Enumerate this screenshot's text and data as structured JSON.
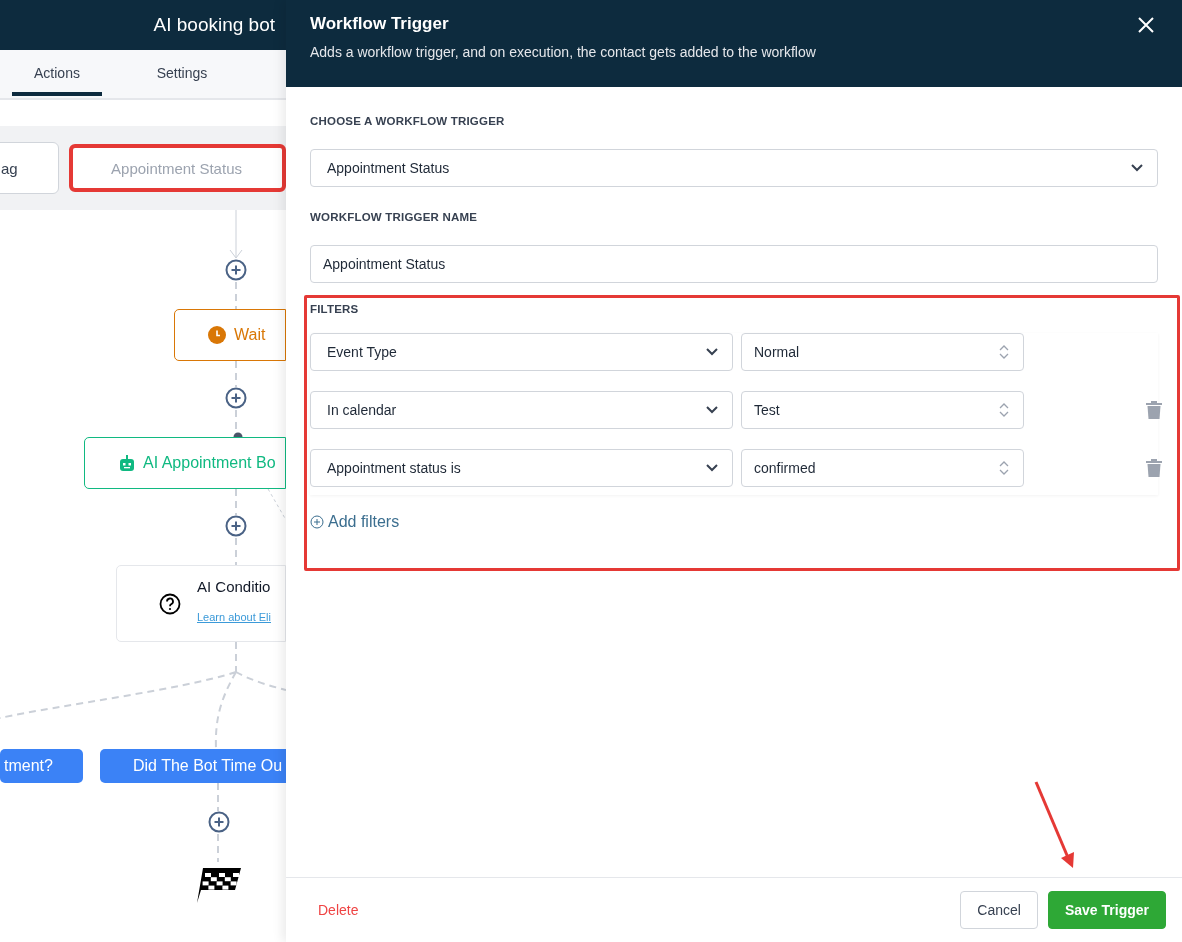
{
  "header": {
    "title": "AI booking bot"
  },
  "tabs": [
    {
      "label": "Actions",
      "selected": true
    },
    {
      "label": "Settings",
      "selected": false
    }
  ],
  "triggers": [
    {
      "label": "ag",
      "selected": false
    },
    {
      "label": "Appointment Status",
      "selected": true
    }
  ],
  "nodes": [
    {
      "kind": "wait",
      "label": "Wait"
    },
    {
      "kind": "bot",
      "label": "AI Appointment Bo"
    },
    {
      "kind": "condition",
      "label": "AI Conditio",
      "link": "Learn about Eli"
    }
  ],
  "branches": [
    {
      "label": "tment?"
    },
    {
      "label": "Did The Bot Time Ou"
    }
  ],
  "drawer": {
    "title": "Workflow Trigger",
    "subtitle": "Adds a workflow trigger, and on execution, the contact gets added to the workflow",
    "trigger_label": "CHOOSE A WORKFLOW TRIGGER",
    "trigger_value": "Appointment Status",
    "name_label": "WORKFLOW TRIGGER NAME",
    "name_value": "Appointment Status",
    "filters_label": "FILTERS",
    "filters": [
      {
        "field": "Event Type",
        "value": "Normal",
        "deletable": false
      },
      {
        "field": "In calendar",
        "value": "Test",
        "deletable": true
      },
      {
        "field": "Appointment status is",
        "value": "confirmed",
        "deletable": true
      }
    ],
    "add_filter": "Add filters",
    "delete": "Delete",
    "cancel": "Cancel",
    "save": "Save Trigger"
  }
}
